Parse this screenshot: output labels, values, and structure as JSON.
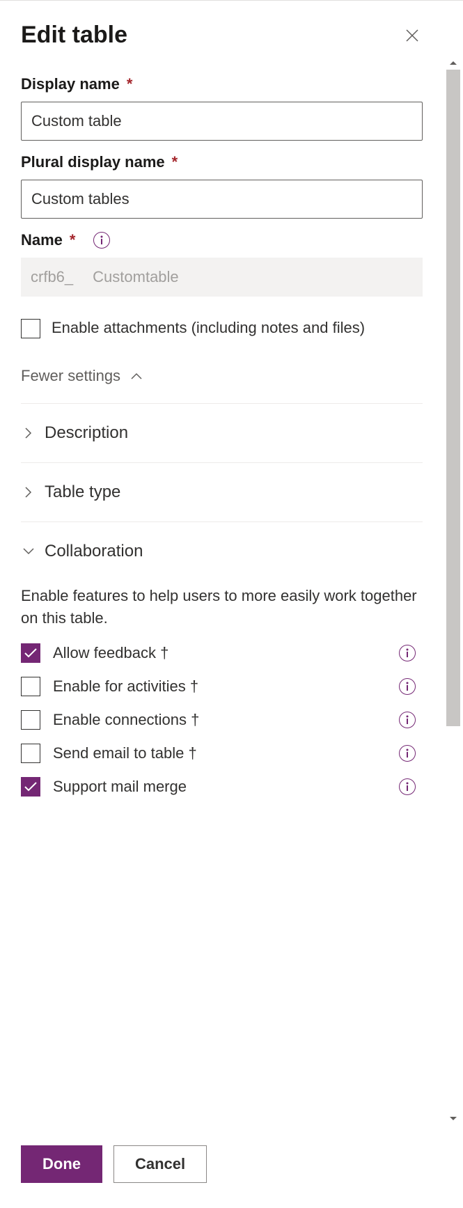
{
  "header": {
    "title": "Edit table"
  },
  "fields": {
    "display_name": {
      "label": "Display name",
      "value": "Custom table"
    },
    "plural_display_name": {
      "label": "Plural display name",
      "value": "Custom tables"
    },
    "name": {
      "label": "Name",
      "prefix": "crfb6_",
      "value": "Customtable"
    },
    "enable_attachments": {
      "label": "Enable attachments (including notes and files)"
    }
  },
  "settings_toggle": {
    "label": "Fewer settings"
  },
  "accordions": {
    "description": {
      "label": "Description"
    },
    "table_type": {
      "label": "Table type"
    },
    "collaboration": {
      "label": "Collaboration",
      "desc": "Enable features to help users to more easily work together on this table.",
      "items": {
        "allow_feedback": {
          "label": "Allow feedback †",
          "checked": true
        },
        "enable_activities": {
          "label": "Enable for activities †",
          "checked": false
        },
        "enable_connections": {
          "label": "Enable connections †",
          "checked": false
        },
        "send_email": {
          "label": "Send email to table †",
          "checked": false
        },
        "support_mail_merge": {
          "label": "Support mail merge",
          "checked": true
        }
      }
    }
  },
  "footer": {
    "done": "Done",
    "cancel": "Cancel"
  }
}
